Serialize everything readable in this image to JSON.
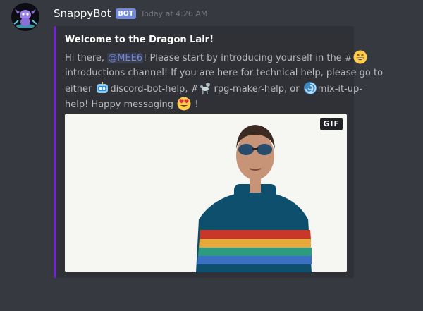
{
  "message": {
    "author": "SnappyBot",
    "bot_tag": "BOT",
    "timestamp": "Today at 4:26 AM",
    "avatar_icon": "purple-dragon-avatar"
  },
  "embed": {
    "accent_color": "#6b2bbf",
    "title": "Welcome to the Dragon Lair!",
    "description": {
      "t1": "Hi there, ",
      "mention": "@MEE6",
      "t2": "! Please start by introducing yourself in the #",
      "emoji_1": "grinning-face-emoji",
      "t3": "introductions channel! If you are here for technical help, please go to",
      "t4": "either ",
      "emoji_2": "robot-emoji",
      "t5": "discord-bot-help, #",
      "emoji_3": "poodle-emoji",
      "t6": "rpg-maker-help, or ",
      "emoji_4": "blue-swirl-emoji",
      "t7": "mix-it-up-",
      "t8": "help! Happy messaging ",
      "emoji_5": "heart-eyes-emoji",
      "t9": " !"
    },
    "gif": {
      "badge": "GIF",
      "alt_icon": "man-in-ski-jacket-gif"
    }
  }
}
